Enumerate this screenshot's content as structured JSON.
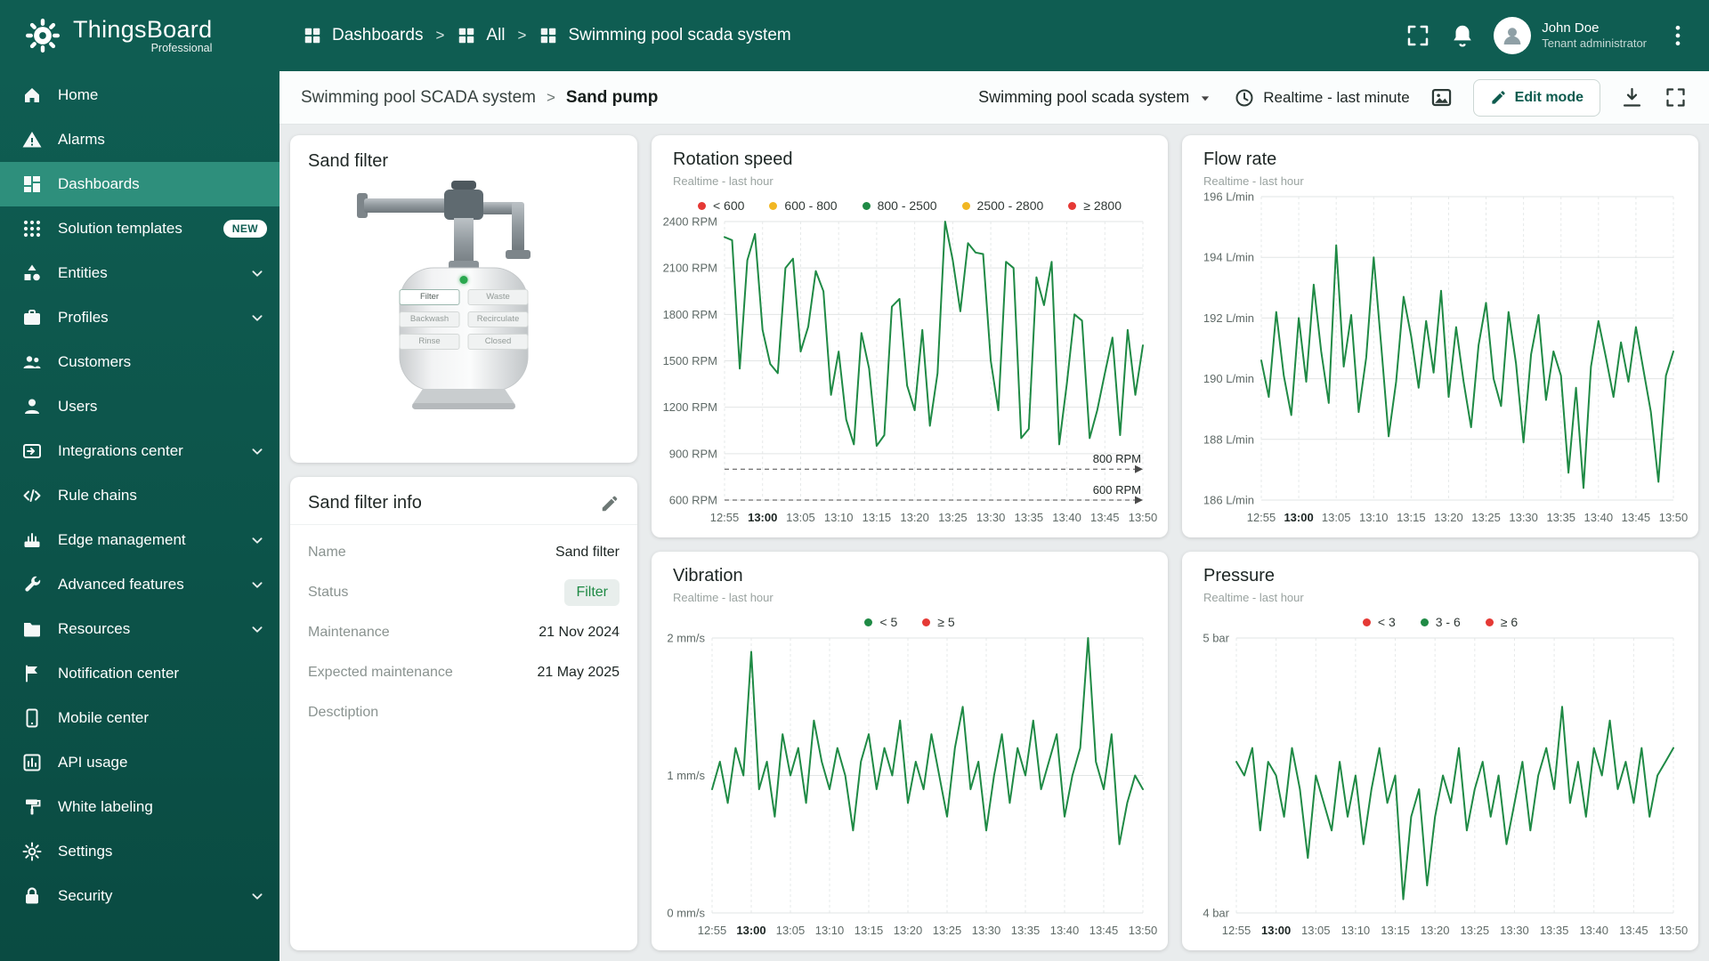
{
  "theme": {
    "primary": "#0f5d52",
    "primary_dark": "#0a4b42",
    "sidebar_active": "#2e8f7c",
    "accent": "#0e5b4e",
    "green": "#1f8a45",
    "yellow": "#f1b723",
    "red": "#e53935",
    "page_bg": "#e9eced"
  },
  "topbar": {
    "logo_title": "ThingsBoard",
    "logo_subtitle": "Professional",
    "separator": ">",
    "breadcrumbs": [
      {
        "label": "Dashboards"
      },
      {
        "label": "All"
      },
      {
        "label": "Swimming pool scada system"
      }
    ],
    "user": {
      "name": "John Doe",
      "role": "Tenant administrator"
    }
  },
  "sidebar": {
    "items": [
      {
        "label": "Home",
        "icon": "home"
      },
      {
        "label": "Alarms",
        "icon": "alarms"
      },
      {
        "label": "Dashboards",
        "icon": "dashboards",
        "active": true
      },
      {
        "label": "Solution templates",
        "icon": "solution-templates",
        "badge": "NEW"
      },
      {
        "label": "Entities",
        "icon": "entities",
        "expandable": true
      },
      {
        "label": "Profiles",
        "icon": "profiles",
        "expandable": true
      },
      {
        "label": "Customers",
        "icon": "customers"
      },
      {
        "label": "Users",
        "icon": "users"
      },
      {
        "label": "Integrations center",
        "icon": "integrations",
        "expandable": true
      },
      {
        "label": "Rule chains",
        "icon": "rule-chains"
      },
      {
        "label": "Edge management",
        "icon": "edge",
        "expandable": true
      },
      {
        "label": "Advanced features",
        "icon": "advanced",
        "expandable": true
      },
      {
        "label": "Resources",
        "icon": "resources",
        "expandable": true
      },
      {
        "label": "Notification center",
        "icon": "notification"
      },
      {
        "label": "Mobile center",
        "icon": "mobile"
      },
      {
        "label": "API usage",
        "icon": "api"
      },
      {
        "label": "White labeling",
        "icon": "white-labeling"
      },
      {
        "label": "Settings",
        "icon": "settings"
      },
      {
        "label": "Security",
        "icon": "security",
        "expandable": true
      }
    ]
  },
  "subheader": {
    "breadcrumb_root": "Swimming pool SCADA system",
    "separator": ">",
    "breadcrumb_current": "Sand pump",
    "entity_select": "Swimming pool scada system",
    "time_window": "Realtime - last minute",
    "edit_button": "Edit mode"
  },
  "sand_filter": {
    "title": "Sand filter",
    "indicator_color": "#2aa84f",
    "buttons": [
      {
        "label": "Filter",
        "active": true
      },
      {
        "label": "Waste",
        "active": false
      },
      {
        "label": "Backwash",
        "active": false
      },
      {
        "label": "Recirculate",
        "active": false
      },
      {
        "label": "Rinse",
        "active": false
      },
      {
        "label": "Closed",
        "active": false
      }
    ]
  },
  "sand_filter_info": {
    "title": "Sand filter info",
    "rows": [
      {
        "label": "Name",
        "value": "Sand filter"
      },
      {
        "label": "Status",
        "value": "Filter",
        "badge": true
      },
      {
        "label": "Maintenance",
        "value": "21 Nov 2024"
      },
      {
        "label": "Expected maintenance",
        "value": "21 May 2025"
      },
      {
        "label": "Desctiption",
        "value": ""
      }
    ]
  },
  "chart_data": [
    {
      "type": "line",
      "title": "Rotation speed",
      "subtitle": "Realtime - last hour",
      "legend": [
        {
          "label": "< 600",
          "color": "#e53935"
        },
        {
          "label": "600 - 800",
          "color": "#f1b723"
        },
        {
          "label": "800 - 2500",
          "color": "#1f8a45"
        },
        {
          "label": "2500 - 2800",
          "color": "#f1b723"
        },
        {
          "label": "≥ 2800",
          "color": "#e53935"
        }
      ],
      "y_unit": "RPM",
      "y_min": 600,
      "y_max": 2400,
      "y_ticks": [
        600,
        900,
        1200,
        1500,
        1800,
        2100,
        2400
      ],
      "x_ticks": [
        "12:55",
        "13:00",
        "13:05",
        "13:10",
        "13:15",
        "13:20",
        "13:25",
        "13:30",
        "13:35",
        "13:40",
        "13:45",
        "13:50"
      ],
      "x_bold": "13:00",
      "thresholds": [
        {
          "value": 800,
          "label": "800 RPM"
        },
        {
          "value": 600,
          "label": "600 RPM"
        }
      ],
      "line_color": "#1f8a45",
      "grid": true,
      "legend_position": "top",
      "values": [
        2300,
        2280,
        1450,
        2150,
        2320,
        1700,
        1480,
        1420,
        2100,
        2160,
        1560,
        1720,
        2080,
        1950,
        1280,
        1560,
        1120,
        960,
        1680,
        1450,
        950,
        1020,
        1850,
        1900,
        1340,
        1180,
        1700,
        1080,
        1420,
        2400,
        2150,
        1820,
        2260,
        2200,
        2190,
        1500,
        1180,
        2140,
        2100,
        1000,
        1060,
        2040,
        1860,
        2140,
        960,
        1350,
        1800,
        1760,
        1000,
        1180,
        1420,
        1650,
        1020,
        1700,
        1280,
        1600
      ]
    },
    {
      "type": "line",
      "title": "Flow rate",
      "subtitle": "Realtime - last hour",
      "legend": [],
      "y_unit": "L/min",
      "y_min": 186,
      "y_max": 196,
      "y_ticks": [
        186,
        188,
        190,
        192,
        194,
        196
      ],
      "x_ticks": [
        "12:55",
        "13:00",
        "13:05",
        "13:10",
        "13:15",
        "13:20",
        "13:25",
        "13:30",
        "13:35",
        "13:40",
        "13:45",
        "13:50"
      ],
      "x_bold": "13:00",
      "line_color": "#1f8a45",
      "grid": true,
      "values": [
        190.6,
        189.4,
        192.2,
        190.1,
        188.8,
        192.0,
        189.9,
        193.1,
        190.9,
        189.2,
        194.4,
        190.4,
        192.1,
        188.9,
        190.7,
        194.0,
        191.1,
        188.1,
        189.9,
        192.7,
        191.4,
        189.7,
        191.9,
        190.2,
        192.9,
        189.4,
        191.7,
        189.9,
        188.4,
        191.1,
        192.5,
        190.0,
        189.1,
        192.2,
        190.5,
        187.9,
        190.8,
        192.1,
        189.3,
        190.9,
        190.1,
        186.9,
        189.7,
        186.4,
        190.4,
        191.9,
        190.7,
        189.4,
        191.2,
        189.9,
        191.7,
        190.3,
        188.9,
        186.6,
        190.1,
        190.9
      ]
    },
    {
      "type": "line",
      "title": "Vibration",
      "subtitle": "Realtime - last hour",
      "legend": [
        {
          "label": "< 5",
          "color": "#1f8a45"
        },
        {
          "label": "≥ 5",
          "color": "#e53935"
        }
      ],
      "y_unit": "mm/s",
      "y_min": 0,
      "y_max": 2,
      "y_ticks": [
        0,
        1,
        2
      ],
      "x_ticks": [
        "12:55",
        "13:00",
        "13:05",
        "13:10",
        "13:15",
        "13:20",
        "13:25",
        "13:30",
        "13:35",
        "13:40",
        "13:45",
        "13:50"
      ],
      "x_bold": "13:00",
      "line_color": "#1f8a45",
      "grid": true,
      "legend_position": "top",
      "values": [
        0.9,
        1.1,
        0.8,
        1.2,
        1.0,
        1.9,
        0.9,
        1.1,
        0.7,
        1.3,
        1.0,
        1.2,
        0.8,
        1.4,
        1.1,
        0.9,
        1.2,
        1.0,
        0.6,
        1.1,
        1.3,
        0.9,
        1.2,
        1.0,
        1.4,
        0.8,
        1.1,
        0.9,
        1.3,
        1.0,
        0.7,
        1.2,
        1.5,
        0.9,
        1.1,
        0.6,
        1.0,
        1.3,
        0.8,
        1.2,
        1.0,
        1.4,
        0.9,
        1.1,
        1.3,
        0.7,
        1.0,
        1.2,
        2.0,
        1.1,
        0.9,
        1.3,
        0.5,
        0.8,
        1.0,
        0.9
      ]
    },
    {
      "type": "line",
      "title": "Pressure",
      "subtitle": "Realtime - last hour",
      "legend": [
        {
          "label": "< 3",
          "color": "#e53935"
        },
        {
          "label": "3 - 6",
          "color": "#1f8a45"
        },
        {
          "label": "≥ 6",
          "color": "#e53935"
        }
      ],
      "y_unit": "bar",
      "y_min": 4,
      "y_max": 5,
      "y_ticks": [
        4,
        5
      ],
      "x_ticks": [
        "12:55",
        "13:00",
        "13:05",
        "13:10",
        "13:15",
        "13:20",
        "13:25",
        "13:30",
        "13:35",
        "13:40",
        "13:45",
        "13:50"
      ],
      "x_bold": "13:00",
      "line_color": "#1f8a45",
      "grid": true,
      "legend_position": "top",
      "values": [
        4.55,
        4.5,
        4.6,
        4.3,
        4.55,
        4.5,
        4.35,
        4.6,
        4.45,
        4.2,
        4.5,
        4.4,
        4.3,
        4.55,
        4.35,
        4.5,
        4.25,
        4.45,
        4.6,
        4.4,
        4.5,
        4.05,
        4.35,
        4.45,
        4.1,
        4.35,
        4.5,
        4.4,
        4.6,
        4.3,
        4.45,
        4.55,
        4.35,
        4.5,
        4.25,
        4.4,
        4.55,
        4.3,
        4.5,
        4.6,
        4.45,
        4.75,
        4.4,
        4.55,
        4.35,
        4.6,
        4.5,
        4.7,
        4.45,
        4.55,
        4.4,
        4.6,
        4.35,
        4.5,
        4.55,
        4.6
      ]
    }
  ]
}
